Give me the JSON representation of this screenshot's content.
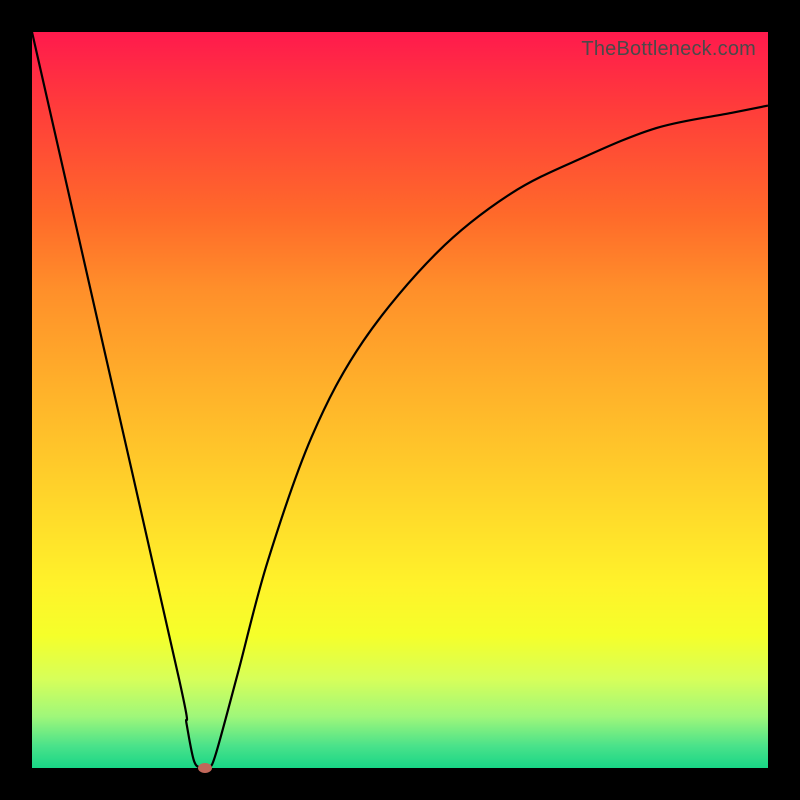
{
  "watermark": "TheBottleneck.com",
  "chart_data": {
    "type": "line",
    "title": "",
    "xlabel": "",
    "ylabel": "",
    "xlim": [
      0,
      100
    ],
    "ylim": [
      0,
      100
    ],
    "grid": false,
    "series": [
      {
        "name": "curve",
        "x": [
          0,
          10,
          20,
          21,
          22,
          23,
          24,
          25,
          28,
          32,
          38,
          45,
          55,
          65,
          75,
          85,
          95,
          100
        ],
        "y": [
          100,
          56,
          12,
          6,
          1,
          0,
          0,
          2,
          13,
          28,
          45,
          58,
          70,
          78,
          83,
          87,
          89,
          90
        ]
      }
    ],
    "marker": {
      "x": 23.5,
      "y": 0
    },
    "colors": {
      "curve": "#000000",
      "marker": "#c1675a",
      "gradient_top": "#ff1a4d",
      "gradient_bottom": "#18d686"
    }
  }
}
